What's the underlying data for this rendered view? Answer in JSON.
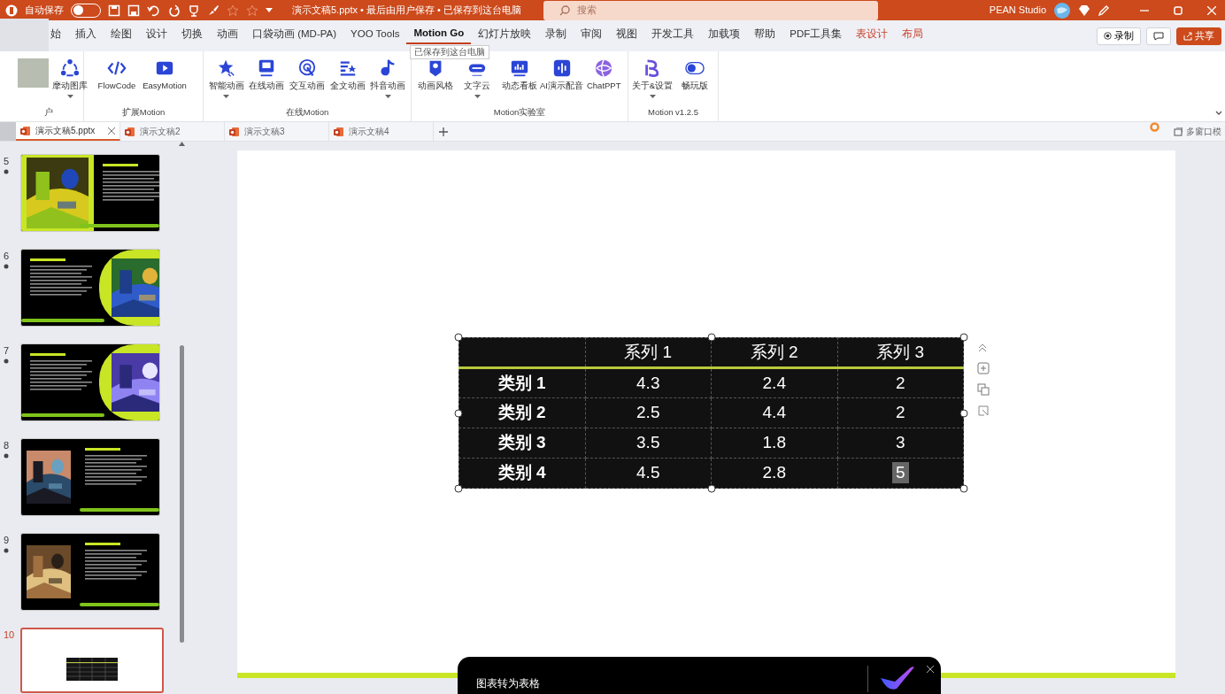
{
  "title_bar": {
    "autosave_label": "自动保存",
    "autosave_on": false,
    "document_title": "演示文稿5.pptx • 最后由用户保存 • 已保存到这台电脑",
    "search_placeholder": "搜索",
    "user_name": "PEAN Studio"
  },
  "ribbon_tabs": [
    {
      "label": "始",
      "selected": false,
      "contextual": false
    },
    {
      "label": "插入",
      "selected": false,
      "contextual": false
    },
    {
      "label": "绘图",
      "selected": false,
      "contextual": false
    },
    {
      "label": "设计",
      "selected": false,
      "contextual": false
    },
    {
      "label": "切换",
      "selected": false,
      "contextual": false
    },
    {
      "label": "动画",
      "selected": false,
      "contextual": false
    },
    {
      "label": "口袋动画 (MD-PA)",
      "selected": false,
      "contextual": false
    },
    {
      "label": "YOO Tools",
      "selected": false,
      "contextual": false
    },
    {
      "label": "Motion Go",
      "selected": true,
      "contextual": false
    },
    {
      "label": "幻灯片放映",
      "selected": false,
      "contextual": false
    },
    {
      "label": "录制",
      "selected": false,
      "contextual": false
    },
    {
      "label": "审阅",
      "selected": false,
      "contextual": false
    },
    {
      "label": "视图",
      "selected": false,
      "contextual": false
    },
    {
      "label": "开发工具",
      "selected": false,
      "contextual": false
    },
    {
      "label": "加载项",
      "selected": false,
      "contextual": false
    },
    {
      "label": "帮助",
      "selected": false,
      "contextual": false
    },
    {
      "label": "PDF工具集",
      "selected": false,
      "contextual": false
    },
    {
      "label": "表设计",
      "selected": false,
      "contextual": true
    },
    {
      "label": "布局",
      "selected": false,
      "contextual": true
    }
  ],
  "ribbon_actions": [
    {
      "kind": "record",
      "label": "录制"
    },
    {
      "kind": "comment"
    },
    {
      "kind": "share",
      "label": "共享"
    }
  ],
  "tooltip": "已保存到这台电脑",
  "ribbon_groups": [
    {
      "label": "户",
      "items": [
        {
          "label": "摩动图库",
          "dropdown": true
        }
      ]
    },
    {
      "label": "扩展Motion",
      "items": [
        {
          "label": "FlowCode",
          "dropdown": false
        },
        {
          "label": "EasyMotion",
          "dropdown": false
        }
      ]
    },
    {
      "label": "在线Motion",
      "items": [
        {
          "label": "智能动画",
          "dropdown": true
        },
        {
          "label": "在线动画",
          "dropdown": false
        },
        {
          "label": "交互动画",
          "dropdown": false
        },
        {
          "label": "全文动画",
          "dropdown": false
        },
        {
          "label": "抖音动画",
          "dropdown": true
        }
      ]
    },
    {
      "label": "Motion实验室",
      "items": [
        {
          "label": "动画风格",
          "dropdown": false
        },
        {
          "label": "文字云",
          "dropdown": true
        },
        {
          "label": "动态看板",
          "dropdown": false
        },
        {
          "label": "AI演示配音",
          "dropdown": false
        },
        {
          "label": "ChatPPT",
          "dropdown": false
        }
      ]
    },
    {
      "label": "Motion v1.2.5",
      "items": [
        {
          "label": "关于&设置",
          "dropdown": true
        },
        {
          "label": "畅玩版",
          "dropdown": false
        }
      ]
    }
  ],
  "document_tabs": [
    {
      "label": "演示文稿5.pptx",
      "selected": true,
      "closable": true
    },
    {
      "label": "演示文稿2",
      "selected": false,
      "closable": false
    },
    {
      "label": "演示文稿3",
      "selected": false,
      "closable": false
    },
    {
      "label": "演示文稿4",
      "selected": false,
      "closable": false
    }
  ],
  "window_mode_label": "多窗口模",
  "slides": [
    {
      "number": "5",
      "kind": "image-left",
      "selected": false
    },
    {
      "number": "6",
      "kind": "image-right",
      "selected": false
    },
    {
      "number": "7",
      "kind": "image-right",
      "selected": false
    },
    {
      "number": "8",
      "kind": "image-left",
      "selected": false
    },
    {
      "number": "9",
      "kind": "image-left",
      "selected": false
    },
    {
      "number": "10",
      "kind": "table",
      "selected": true
    }
  ],
  "table": {
    "columns": [
      "系列 1",
      "系列 2",
      "系列 3"
    ],
    "rows": [
      {
        "label": "类别 1",
        "cells": [
          {
            "value": "4.3",
            "selected": false
          },
          {
            "value": "2.4",
            "selected": false
          },
          {
            "value": "2",
            "selected": false
          }
        ]
      },
      {
        "label": "类别 2",
        "cells": [
          {
            "value": "2.5",
            "selected": false
          },
          {
            "value": "4.4",
            "selected": false
          },
          {
            "value": "2",
            "selected": false
          }
        ]
      },
      {
        "label": "类别 3",
        "cells": [
          {
            "value": "3.5",
            "selected": false
          },
          {
            "value": "1.8",
            "selected": false
          },
          {
            "value": "3",
            "selected": false
          }
        ]
      },
      {
        "label": "类别 4",
        "cells": [
          {
            "value": "4.5",
            "selected": false
          },
          {
            "value": "2.8",
            "selected": false
          },
          {
            "value": "5",
            "selected": true
          }
        ]
      }
    ]
  },
  "popup": {
    "title": "图表转为表格"
  }
}
